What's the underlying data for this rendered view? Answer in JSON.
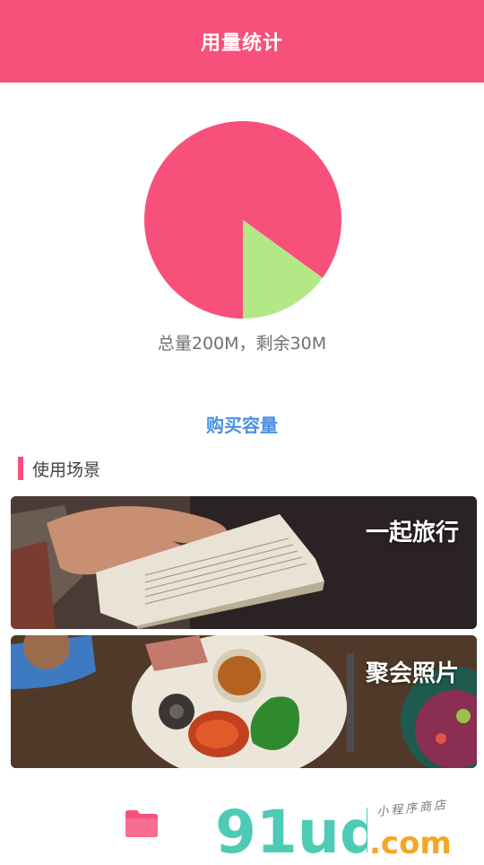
{
  "header": {
    "title": "用量统计"
  },
  "chart_data": {
    "type": "pie",
    "slices": [
      {
        "label": "used",
        "value": 170,
        "color": "#f7507a"
      },
      {
        "label": "remaining",
        "value": 30,
        "color": "#b4e887"
      }
    ]
  },
  "summary": {
    "text": "总量200M，剩余30M"
  },
  "buy": {
    "label": "购买容量"
  },
  "section": {
    "title": "使用场景"
  },
  "cards": [
    {
      "label": "一起旅行"
    },
    {
      "label": "聚会照片"
    }
  ],
  "bottom": {
    "watermark_main": "91ud",
    "watermark_domain": ".com",
    "watermark_tagline": "小程序商店"
  },
  "colors": {
    "accent": "#f7507a",
    "link": "#4a90e2",
    "remaining": "#b4e887"
  }
}
